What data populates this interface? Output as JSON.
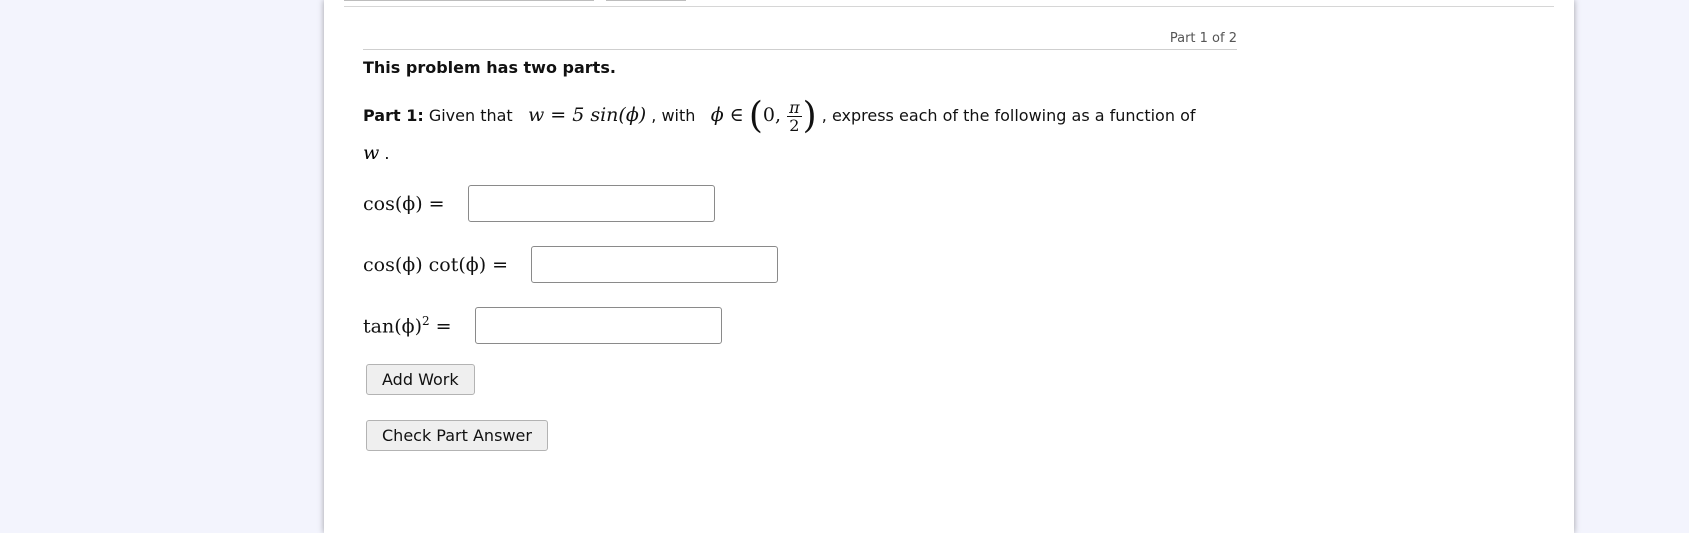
{
  "header": {
    "part_indicator": "Part 1 of 2"
  },
  "problem": {
    "intro": "This problem has two parts.",
    "part_label": "Part 1:",
    "given_text": "Given that",
    "with_text": ", with",
    "express_text": ", express each of the following as a function of",
    "equation_w": "w = 5 sin(ϕ)",
    "domain_phi": "ϕ ∈",
    "interval_open": "0,",
    "frac_num": "π",
    "frac_den": "2",
    "function_var": "w",
    "period": "."
  },
  "questions": [
    {
      "label": "cos(ϕ) =",
      "value": ""
    },
    {
      "label": "cos(ϕ) cot(ϕ) =",
      "value": ""
    },
    {
      "label_base": "tan(ϕ)",
      "label_exp": "2",
      "label_eq": "=",
      "value": ""
    }
  ],
  "buttons": {
    "add_work": "Add Work",
    "check_part": "Check Part Answer"
  }
}
